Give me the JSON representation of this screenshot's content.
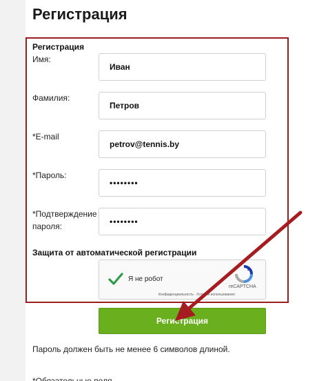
{
  "page": {
    "title": "Регистрация"
  },
  "form": {
    "section_title": "Регистрация",
    "fields": {
      "first_name": {
        "label": "Имя:",
        "value": "Иван"
      },
      "last_name": {
        "label": "Фамилия:",
        "value": "Петров"
      },
      "email": {
        "label": "*E-mail",
        "value": "petrov@tennis.by"
      },
      "password": {
        "label": "*Пароль:",
        "value": "••••••••"
      },
      "confirm_label_line1": "*Подтверждение",
      "confirm_label_line2": "пароля:",
      "confirm_value": "••••••••"
    },
    "protection_title": "Защита от автоматической регистрации",
    "captcha": {
      "label": "Я не робот",
      "brand": "reCAPTCHA",
      "links": "Конфиденциальность - Условия использования",
      "checked": true,
      "check_color": "#2e9a4a"
    },
    "submit_label": "Регистрация",
    "hint": "Пароль должен быть не менее 6 символов длиной.",
    "required_note": "*Обязательные поля"
  },
  "colors": {
    "frame": "#9b1c1f",
    "arrow": "#a51d21",
    "button": "#6aaf1e"
  },
  "icons": {
    "captcha_check": "checkmark-icon",
    "captcha_logo": "recaptcha-logo-icon",
    "annotation": "arrow-icon"
  }
}
